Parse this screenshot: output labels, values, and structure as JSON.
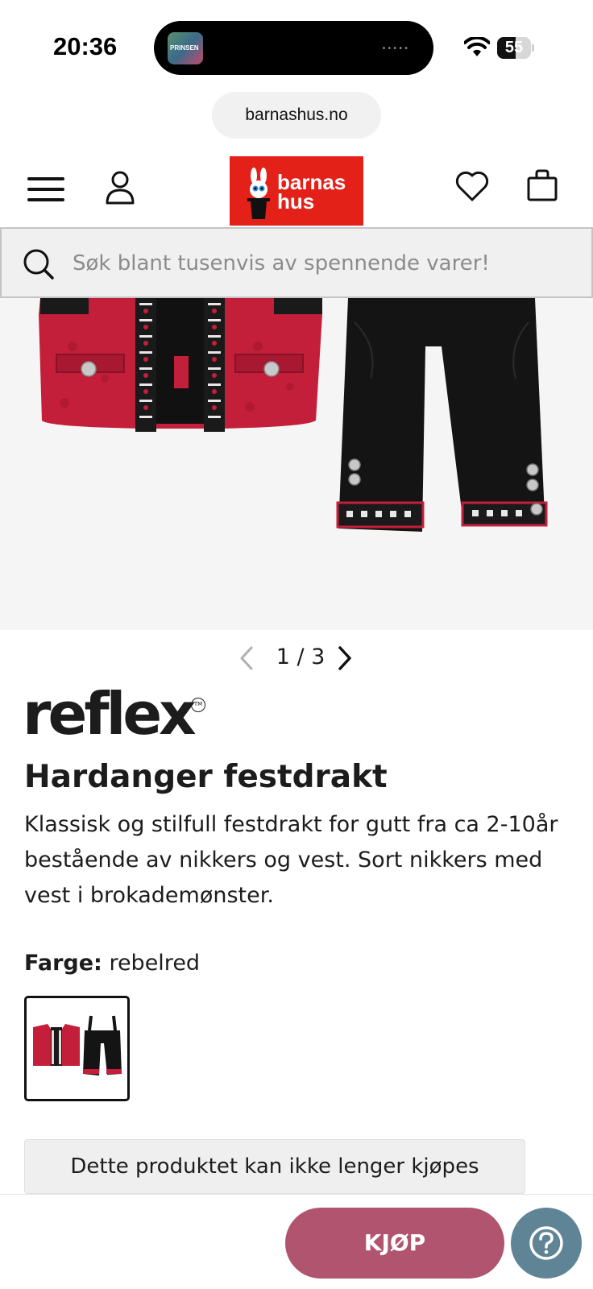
{
  "status_bar": {
    "time": "20:36",
    "now_playing_thumb_text": "PRINSEN",
    "battery_percent": 55,
    "battery_text": "55"
  },
  "browser": {
    "url": "barnashus.no"
  },
  "header": {
    "logo_text_line1": "barnas",
    "logo_text_line2": "hus",
    "logo_color": "#e32119"
  },
  "search": {
    "placeholder": "Søk blant tusenvis av spennende varer!"
  },
  "gallery": {
    "pager_text": "1 / 3",
    "current": 1,
    "total": 3
  },
  "product": {
    "brand": "reflex",
    "brand_tm": "TM",
    "title": "Hardanger festdrakt",
    "description": "Klassisk og stilfull festdrakt for gutt fra ca 2-10år bestående av nikkers og vest. Sort nikkers med vest i brokademønster.",
    "color_label": "Farge:",
    "color_value": "rebelred",
    "unavailable_notice": "Dette produktet kan ikke lenger kjøpes"
  },
  "actions": {
    "buy_label": "KJØP",
    "buy_color": "#b05470",
    "help_color": "#5f8495"
  }
}
